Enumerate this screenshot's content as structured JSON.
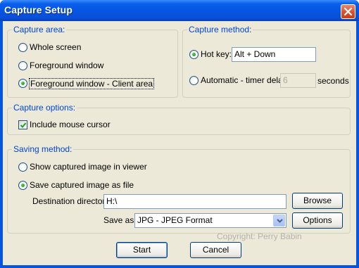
{
  "window": {
    "title": "Capture Setup",
    "close_icon": "close-icon"
  },
  "capture_area": {
    "legend": "Capture area:",
    "options": [
      {
        "label": "Whole screen",
        "checked": false
      },
      {
        "label": "Foreground window",
        "checked": false
      },
      {
        "label": "Foreground window - Client area",
        "checked": true
      }
    ]
  },
  "capture_method": {
    "legend": "Capture method:",
    "hotkey_label": "Hot key:",
    "hotkey_value": "Alt + Down",
    "hotkey_checked": true,
    "automatic_label": "Automatic - timer delay:",
    "automatic_checked": false,
    "delay_value": "6",
    "seconds_label": "seconds"
  },
  "capture_options": {
    "legend": "Capture options:",
    "include_cursor_label": "Include mouse cursor",
    "include_cursor_checked": true
  },
  "saving_method": {
    "legend": "Saving method:",
    "show_viewer_label": "Show captured image in viewer",
    "show_viewer_checked": false,
    "save_file_label": "Save captured image as file",
    "save_file_checked": true,
    "destination_label": "Destination directory:",
    "destination_value": "H:\\",
    "browse_label": "Browse",
    "save_as_label": "Save as:",
    "save_as_value": "JPG - JPEG Format",
    "options_label": "Options"
  },
  "watermark": "Copyright:  Perry Babin",
  "buttons": {
    "start": "Start",
    "cancel": "Cancel"
  },
  "colors": {
    "title_bar": "#0a5fea",
    "client_bg": "#ece9d8",
    "legend_text": "#0046d5",
    "close_button": "#d9502e"
  }
}
